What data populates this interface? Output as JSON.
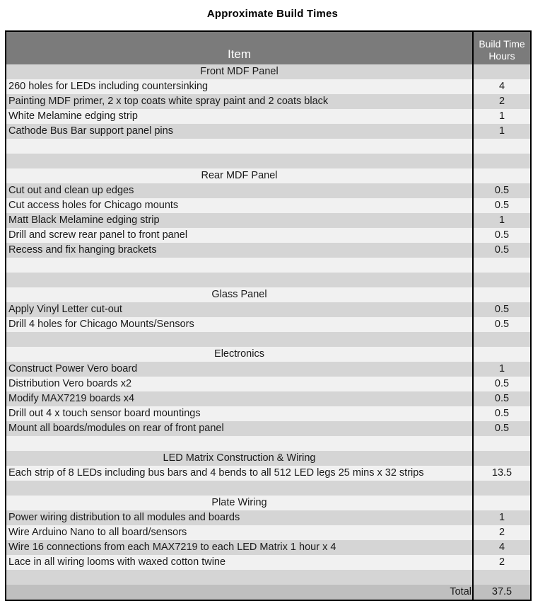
{
  "page": {
    "title": "Approximate Build Times"
  },
  "table": {
    "columns": {
      "item": "Item",
      "hours_line1": "Build Time",
      "hours_line2": "Hours"
    },
    "colors": {
      "header_background": "#7b7b7b",
      "header_text": "#ffffff",
      "row_shade_dark": "#d5d5d5",
      "row_shade_light": "#f1f1f1",
      "total_background": "#bfbfbf",
      "border": "#000000"
    },
    "rows": [
      {
        "kind": "section",
        "item": "Front MDF Panel",
        "hours": ""
      },
      {
        "kind": "data",
        "item": "260 holes for LEDs including countersinking",
        "hours": "4"
      },
      {
        "kind": "data",
        "item": "Painting MDF primer, 2 x top coats white spray paint and 2 coats black",
        "hours": "2"
      },
      {
        "kind": "data",
        "item": "White Melamine edging strip",
        "hours": "1"
      },
      {
        "kind": "data",
        "item": "Cathode Bus Bar support panel pins",
        "hours": "1"
      },
      {
        "kind": "blank",
        "item": "",
        "hours": ""
      },
      {
        "kind": "blank",
        "item": "",
        "hours": ""
      },
      {
        "kind": "section",
        "item": "Rear MDF Panel",
        "hours": ""
      },
      {
        "kind": "data",
        "item": "Cut out and clean up edges",
        "hours": "0.5"
      },
      {
        "kind": "data",
        "item": "Cut access holes for Chicago mounts",
        "hours": "0.5"
      },
      {
        "kind": "data",
        "item": "Matt Black Melamine edging strip",
        "hours": "1"
      },
      {
        "kind": "data",
        "item": "Drill and screw rear panel to front panel",
        "hours": "0.5"
      },
      {
        "kind": "data",
        "item": "Recess and fix hanging brackets",
        "hours": "0.5"
      },
      {
        "kind": "blank",
        "item": "",
        "hours": ""
      },
      {
        "kind": "blank",
        "item": "",
        "hours": ""
      },
      {
        "kind": "section",
        "item": "Glass Panel",
        "hours": ""
      },
      {
        "kind": "data",
        "item": "Apply Vinyl Letter cut-out",
        "hours": "0.5"
      },
      {
        "kind": "data",
        "item": "Drill 4 holes for Chicago Mounts/Sensors",
        "hours": "0.5"
      },
      {
        "kind": "blank",
        "item": "",
        "hours": ""
      },
      {
        "kind": "section",
        "item": "Electronics",
        "hours": ""
      },
      {
        "kind": "data",
        "item": "Construct Power Vero board",
        "hours": "1"
      },
      {
        "kind": "data",
        "item": "Distribution Vero boards x2",
        "hours": "0.5"
      },
      {
        "kind": "data",
        "item": "Modify MAX7219 boards x4",
        "hours": "0.5"
      },
      {
        "kind": "data",
        "item": "Drill out 4 x touch sensor board mountings",
        "hours": "0.5"
      },
      {
        "kind": "data",
        "item": "Mount all boards/modules on rear of front panel",
        "hours": "0.5"
      },
      {
        "kind": "blank",
        "item": "",
        "hours": ""
      },
      {
        "kind": "section",
        "item": "LED Matrix Construction & Wiring",
        "hours": ""
      },
      {
        "kind": "data",
        "item": "Each strip of 8 LEDs including bus bars and 4 bends to all 512 LED legs 25 mins x 32 strips",
        "hours": "13.5"
      },
      {
        "kind": "blank",
        "item": "",
        "hours": ""
      },
      {
        "kind": "section",
        "item": "Plate Wiring",
        "hours": ""
      },
      {
        "kind": "data",
        "item": "Power wiring distribution to all modules and boards",
        "hours": "1"
      },
      {
        "kind": "data",
        "item": "Wire Arduino Nano to all board/sensors",
        "hours": "2"
      },
      {
        "kind": "data",
        "item": "Wire 16 connections from each MAX7219 to each LED Matrix 1 hour x 4",
        "hours": "4"
      },
      {
        "kind": "data",
        "item": "Lace in all wiring looms with waxed cotton twine",
        "hours": "2"
      },
      {
        "kind": "blank",
        "item": "",
        "hours": ""
      },
      {
        "kind": "total",
        "item": "Total",
        "hours": "37.5"
      }
    ]
  }
}
